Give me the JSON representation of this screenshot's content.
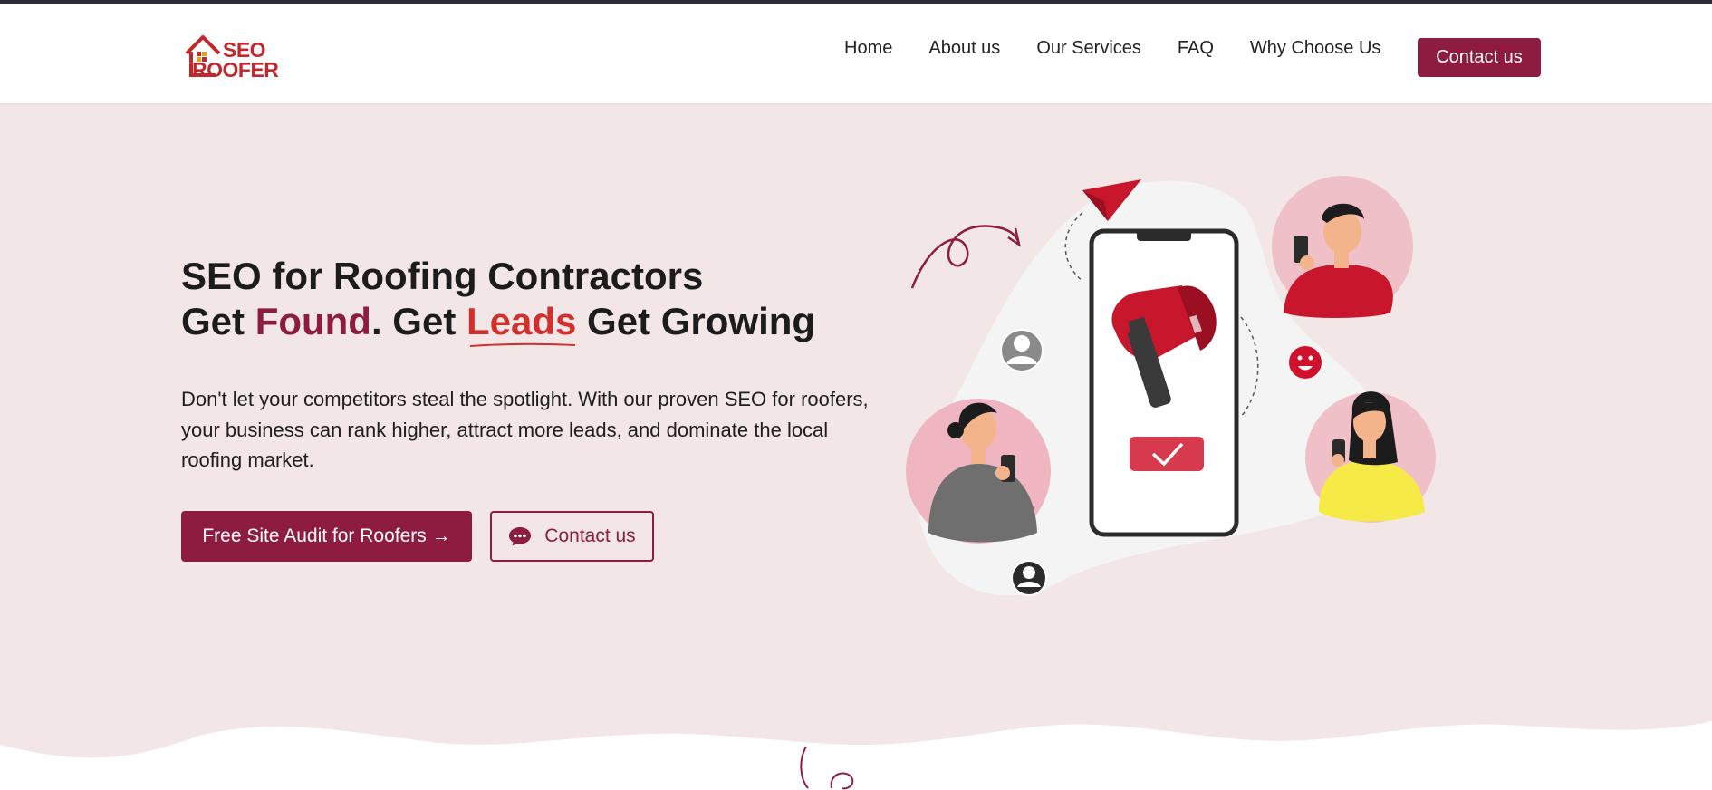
{
  "header": {
    "logo_text_line1": "SEO",
    "logo_text_line2": "ROOFER",
    "nav": [
      {
        "label": "Home"
      },
      {
        "label": "About us"
      },
      {
        "label": "Our Services"
      },
      {
        "label": "FAQ"
      },
      {
        "label": "Why Choose Us"
      }
    ],
    "cta_label": "Contact us"
  },
  "hero": {
    "title_line1": "SEO for Roofing Contractors",
    "title_get1": "Get ",
    "title_found": "Found",
    "title_get2": ". Get ",
    "title_leads": "Leads",
    "title_get3": " Get Growing",
    "description": "Don't let your competitors steal the spotlight. With our proven SEO for roofers, your business can rank higher, attract more leads, and dominate the local roofing market.",
    "primary_button": "Free Site Audit for Roofers →",
    "secondary_button": "Contact us"
  },
  "colors": {
    "brand": "#8d1c40",
    "accent_red": "#d0312d",
    "hero_bg": "#f2e6e7",
    "header_bg": "#ffffff"
  },
  "icons": {
    "logo": "house-logo-icon",
    "chat": "chat-bubble-icon",
    "megaphone": "megaphone-icon",
    "checkmark": "checkmark-icon",
    "paper_plane": "paper-plane-icon",
    "user_avatar": "user-avatar-icon",
    "smiley": "smiley-icon"
  }
}
